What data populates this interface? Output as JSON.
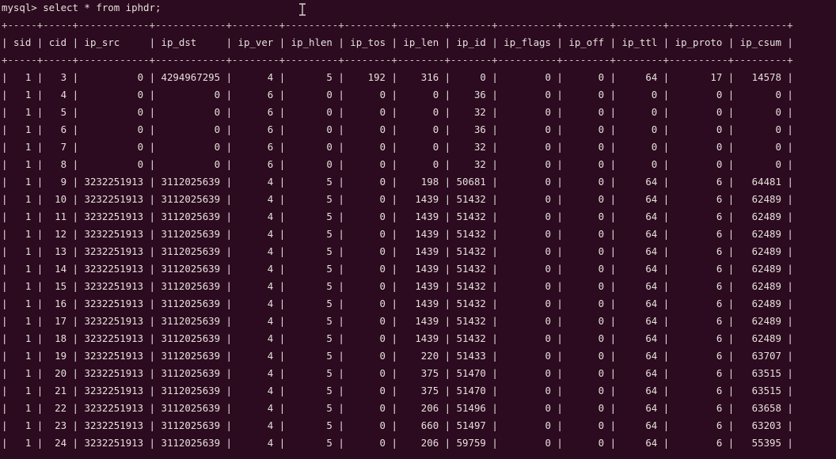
{
  "terminal": {
    "command": "mysql> select * from iphdr;",
    "columns": [
      "sid",
      "cid",
      "ip_src",
      "ip_dst",
      "ip_ver",
      "ip_hlen",
      "ip_tos",
      "ip_len",
      "ip_id",
      "ip_flags",
      "ip_off",
      "ip_ttl",
      "ip_proto",
      "ip_csum"
    ],
    "rows": [
      [
        "1",
        "3",
        "0",
        "4294967295",
        "4",
        "5",
        "192",
        "316",
        "0",
        "0",
        "0",
        "64",
        "17",
        "14578"
      ],
      [
        "1",
        "4",
        "0",
        "0",
        "6",
        "0",
        "0",
        "0",
        "36",
        "0",
        "0",
        "0",
        "0",
        "0"
      ],
      [
        "1",
        "5",
        "0",
        "0",
        "6",
        "0",
        "0",
        "0",
        "32",
        "0",
        "0",
        "0",
        "0",
        "0"
      ],
      [
        "1",
        "6",
        "0",
        "0",
        "6",
        "0",
        "0",
        "0",
        "36",
        "0",
        "0",
        "0",
        "0",
        "0"
      ],
      [
        "1",
        "7",
        "0",
        "0",
        "6",
        "0",
        "0",
        "0",
        "32",
        "0",
        "0",
        "0",
        "0",
        "0"
      ],
      [
        "1",
        "8",
        "0",
        "0",
        "6",
        "0",
        "0",
        "0",
        "32",
        "0",
        "0",
        "0",
        "0",
        "0"
      ],
      [
        "1",
        "9",
        "3232251913",
        "3112025639",
        "4",
        "5",
        "0",
        "198",
        "50681",
        "0",
        "0",
        "64",
        "6",
        "64481"
      ],
      [
        "1",
        "10",
        "3232251913",
        "3112025639",
        "4",
        "5",
        "0",
        "1439",
        "51432",
        "0",
        "0",
        "64",
        "6",
        "62489"
      ],
      [
        "1",
        "11",
        "3232251913",
        "3112025639",
        "4",
        "5",
        "0",
        "1439",
        "51432",
        "0",
        "0",
        "64",
        "6",
        "62489"
      ],
      [
        "1",
        "12",
        "3232251913",
        "3112025639",
        "4",
        "5",
        "0",
        "1439",
        "51432",
        "0",
        "0",
        "64",
        "6",
        "62489"
      ],
      [
        "1",
        "13",
        "3232251913",
        "3112025639",
        "4",
        "5",
        "0",
        "1439",
        "51432",
        "0",
        "0",
        "64",
        "6",
        "62489"
      ],
      [
        "1",
        "14",
        "3232251913",
        "3112025639",
        "4",
        "5",
        "0",
        "1439",
        "51432",
        "0",
        "0",
        "64",
        "6",
        "62489"
      ],
      [
        "1",
        "15",
        "3232251913",
        "3112025639",
        "4",
        "5",
        "0",
        "1439",
        "51432",
        "0",
        "0",
        "64",
        "6",
        "62489"
      ],
      [
        "1",
        "16",
        "3232251913",
        "3112025639",
        "4",
        "5",
        "0",
        "1439",
        "51432",
        "0",
        "0",
        "64",
        "6",
        "62489"
      ],
      [
        "1",
        "17",
        "3232251913",
        "3112025639",
        "4",
        "5",
        "0",
        "1439",
        "51432",
        "0",
        "0",
        "64",
        "6",
        "62489"
      ],
      [
        "1",
        "18",
        "3232251913",
        "3112025639",
        "4",
        "5",
        "0",
        "1439",
        "51432",
        "0",
        "0",
        "64",
        "6",
        "62489"
      ],
      [
        "1",
        "19",
        "3232251913",
        "3112025639",
        "4",
        "5",
        "0",
        "220",
        "51433",
        "0",
        "0",
        "64",
        "6",
        "63707"
      ],
      [
        "1",
        "20",
        "3232251913",
        "3112025639",
        "4",
        "5",
        "0",
        "375",
        "51470",
        "0",
        "0",
        "64",
        "6",
        "63515"
      ],
      [
        "1",
        "21",
        "3232251913",
        "3112025639",
        "4",
        "5",
        "0",
        "375",
        "51470",
        "0",
        "0",
        "64",
        "6",
        "63515"
      ],
      [
        "1",
        "22",
        "3232251913",
        "3112025639",
        "4",
        "5",
        "0",
        "206",
        "51496",
        "0",
        "0",
        "64",
        "6",
        "63658"
      ],
      [
        "1",
        "23",
        "3232251913",
        "3112025639",
        "4",
        "5",
        "0",
        "660",
        "51497",
        "0",
        "0",
        "64",
        "6",
        "63203"
      ],
      [
        "1",
        "24",
        "3232251913",
        "3112025639",
        "4",
        "5",
        "0",
        "206",
        "59759",
        "0",
        "0",
        "64",
        "6",
        "55395"
      ]
    ]
  },
  "icons": {
    "cursor": "text-cursor-icon"
  },
  "colors": {
    "background": "#2c0a1f",
    "text": "#e6e1dc"
  }
}
